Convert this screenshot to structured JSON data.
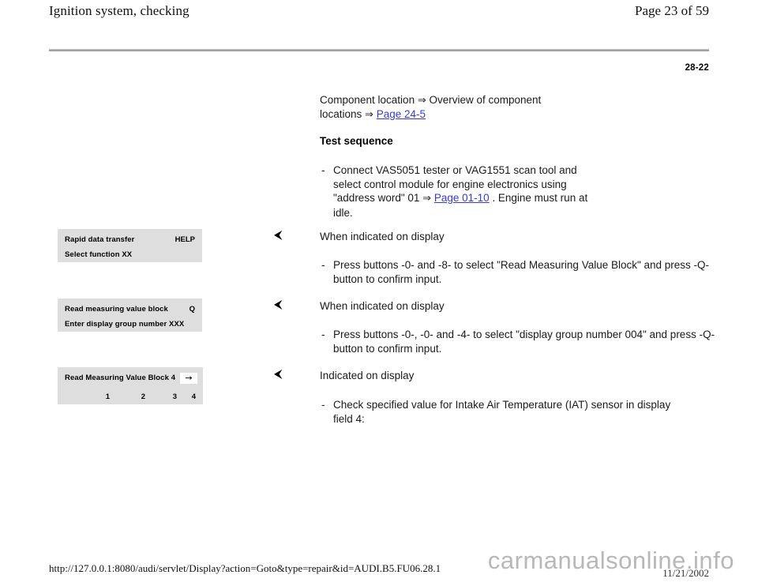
{
  "header": {
    "title": "Ignition system, checking",
    "page_label": "Page 23 of 59"
  },
  "section_code": "28-22",
  "intro": {
    "line1_pre": "Component location ",
    "arrow": "⇒",
    "line1_mid": " Overview of component",
    "line2_pre": "locations ",
    "link_text": "Page 24-5"
  },
  "test_sequence_heading": "Test sequence",
  "steps": [
    {
      "id": "step-connect",
      "dash": "-",
      "text_part1": "Connect VAS5051 tester or VAG1551 scan tool and select control module for engine electronics using \"address word\" 01 ",
      "arrow": "⇒",
      "link_text": "Page 01-10",
      "text_part2": " . Engine must run at idle."
    }
  ],
  "blocks": [
    {
      "id": "block-1",
      "marker": "◀",
      "heading": "When indicated on display",
      "dash": "-",
      "bullet": "Press buttons -0- and -8- to select \"Read Measuring Value Block\" and press -Q- button to confirm input.",
      "display": {
        "name": "rapid-data-transfer-display",
        "row1_left": "Rapid data transfer",
        "row1_right": "HELP",
        "row2_left": "Select function XX",
        "row2_right": ""
      }
    },
    {
      "id": "block-2",
      "marker": "◀",
      "heading": "When indicated on display",
      "dash": "-",
      "bullet": "Press buttons -0-, -0- and -4- to select \"display group number 004\" and press -Q- button to confirm input.",
      "display": {
        "name": "read-measuring-value-block-display",
        "row1_left": "Read measuring value block",
        "row1_right": "Q",
        "row2_left": "Enter display group number XXX",
        "row2_right": ""
      }
    },
    {
      "id": "block-3",
      "marker": "◀",
      "heading": "Indicated on display",
      "dash": "-",
      "bullet": "Check specified value for Intake Air Temperature (IAT) sensor in display field 4:",
      "display": {
        "name": "read-measuring-value-block-4-display",
        "row1_left": "Read Measuring Value Block 4",
        "row1_right_icon": "→",
        "fields": [
          "1",
          "2",
          "3",
          "4"
        ]
      }
    }
  ],
  "footer": {
    "url": "http://127.0.0.1:8080/audi/servlet/Display?action=Goto&type=repair&id=AUDI.B5.FU06.28.1",
    "date": "11/21/2002",
    "watermark": "carmanualsonline.info"
  },
  "colors": {
    "link": "#3838d8",
    "display_bg": "#dedede",
    "rule": "#a9a9a9",
    "watermark": "#b8b8b8"
  }
}
